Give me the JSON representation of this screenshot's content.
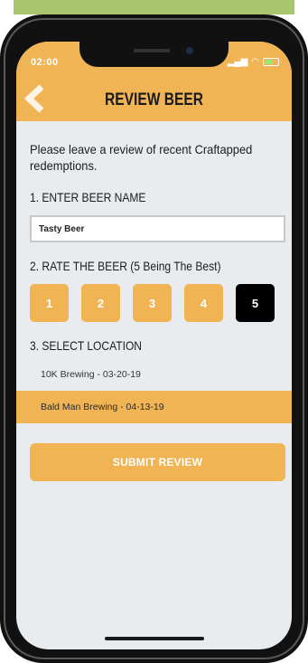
{
  "status_bar": {
    "time": "02:00",
    "icons": "wifi-icon battery-icon"
  },
  "header": {
    "title": "REVIEW BEER",
    "back_icon": "chevron-left-icon"
  },
  "intro_text": "Please leave a review of recent Craftapped redemptions.",
  "section_beer": {
    "label": "1. ENTER BEER NAME",
    "value": "Tasty Beer"
  },
  "section_rating": {
    "label": "2. RATE THE BEER (5 Being The Best)",
    "options": [
      "1",
      "2",
      "3",
      "4",
      "5"
    ],
    "selected": "5"
  },
  "section_location": {
    "label": "3. SELECT LOCATION",
    "locations": [
      "10K Brewing - 03-20-19",
      "Bald Man Brewing - 04-13-19"
    ],
    "selected_index": 1
  },
  "submit_label": "SUBMIT REVIEW",
  "colors": {
    "accent": "#f0b455",
    "background": "#e9ecee",
    "selected_rating": "#000000"
  }
}
